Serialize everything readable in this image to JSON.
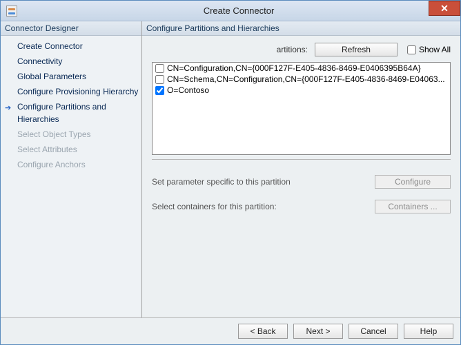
{
  "window": {
    "title": "Create Connector",
    "close_glyph": "✕"
  },
  "sidebar": {
    "header": "Connector Designer",
    "items": [
      {
        "label": "Create Connector",
        "state": "done"
      },
      {
        "label": "Connectivity",
        "state": "done"
      },
      {
        "label": "Global Parameters",
        "state": "done"
      },
      {
        "label": "Configure Provisioning Hierarchy",
        "state": "done"
      },
      {
        "label": "Configure Partitions and Hierarchies",
        "state": "current"
      },
      {
        "label": "Select Object Types",
        "state": "disabled"
      },
      {
        "label": "Select Attributes",
        "state": "disabled"
      },
      {
        "label": "Configure Anchors",
        "state": "disabled"
      }
    ]
  },
  "main": {
    "header": "Configure Partitions and Hierarchies",
    "partitions_trunc_label": "artitions:",
    "refresh_label": "Refresh",
    "showall_label": "Show All",
    "showall_checked": false,
    "partitions": [
      {
        "checked": false,
        "text": "CN=Configuration,CN={000F127F-E405-4836-8469-E0406395B64A}"
      },
      {
        "checked": false,
        "text": "CN=Schema,CN=Configuration,CN={000F127F-E405-4836-8469-E04063..."
      },
      {
        "checked": true,
        "text": "O=Contoso"
      }
    ],
    "param_label_1": "Set parameter specific to this partition",
    "param_button_1": "Configure",
    "param_label_2": "Select containers for this partition:",
    "param_button_2": "Containers ..."
  },
  "footer": {
    "back": "<  Back",
    "next": "Next  >",
    "cancel": "Cancel",
    "help": "Help"
  }
}
